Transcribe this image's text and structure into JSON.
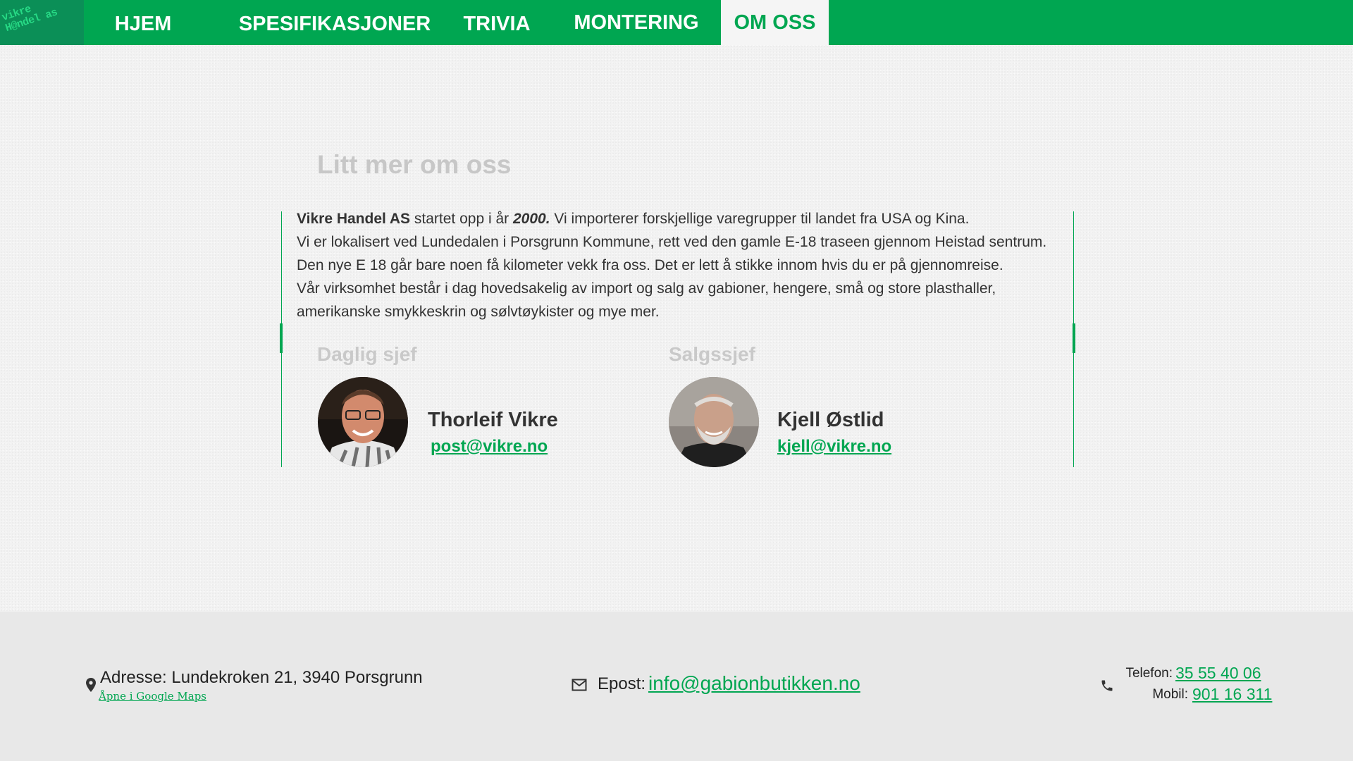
{
  "logo": {
    "line1": "vikre",
    "line2": "H@ndel as"
  },
  "nav": {
    "items": [
      {
        "label": "HJEM"
      },
      {
        "label": "SPESIFIKASJONER"
      },
      {
        "label": "TRIVIA"
      },
      {
        "label": "MONTERING"
      },
      {
        "label": "OM OSS"
      }
    ],
    "active": "OM OSS"
  },
  "about": {
    "title": "Litt mer om oss",
    "company": "Vikre Handel AS",
    "p1_mid": " startet opp i år ",
    "year": "2000.",
    "p1_end": " Vi importerer forskjellige varegrupper til landet fra USA og Kina.",
    "line2": "Vi er lokalisert ved Lundedalen i Porsgrunn Kommune, rett ved den gamle E-18 traseen gjennom Heistad sentrum.",
    "line3": "Den nye E 18 går bare noen få kilometer vekk fra oss. Det er lett å stikke innom hvis du er på gjennomreise.",
    "line4": "Vår virksomhet består i dag hovedsakelig av import og salg av gabioner, hengere, små og store plasthaller, amerikanske smykkeskrin og sølvtøykister og mye mer."
  },
  "people": [
    {
      "role": "Daglig sjef",
      "name": "Thorleif Vikre",
      "email": "post@vikre.no"
    },
    {
      "role": "Salgssjef",
      "name": "Kjell Østlid",
      "email": "kjell@vikre.no"
    }
  ],
  "footer": {
    "address_label": "Adresse:",
    "address": "Lundekroken 21, 3940 Porsgrunn",
    "maps_link": "Åpne i Google Maps",
    "email_label": "Epost:",
    "email": "info@gabionbutikken.no",
    "phone_label": "Telefon:",
    "phone": "35 55 40 06",
    "mobile_label": "Mobil:",
    "mobile": "901 16 311"
  },
  "colors": {
    "brand_green": "#00a651",
    "logo_bg": "#0b8f57",
    "footer_bg": "#e8e8e8"
  },
  "icons": [
    "map-pin-icon",
    "mail-icon",
    "phone-icon"
  ]
}
